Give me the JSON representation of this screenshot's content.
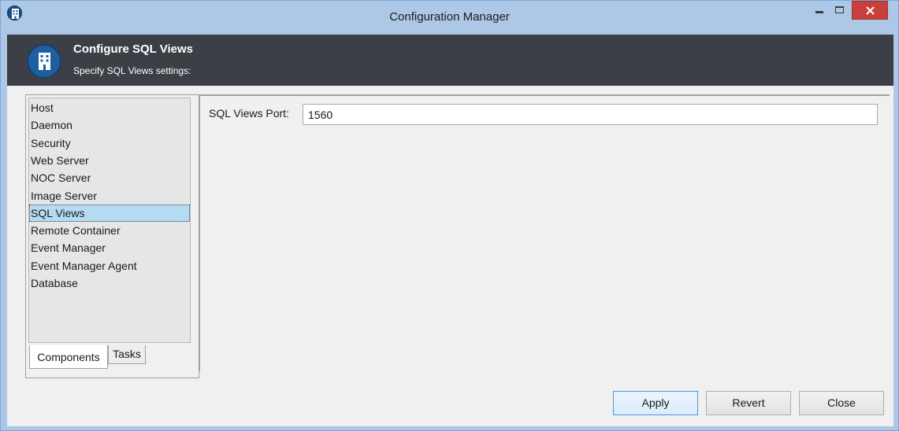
{
  "window": {
    "title": "Configuration Manager"
  },
  "banner": {
    "title": "Configure SQL Views",
    "subtitle": "Specify SQL Views settings:"
  },
  "tree": {
    "items": [
      {
        "label": "Host",
        "selected": false
      },
      {
        "label": "Daemon",
        "selected": false
      },
      {
        "label": "Security",
        "selected": false
      },
      {
        "label": "Web Server",
        "selected": false
      },
      {
        "label": "NOC Server",
        "selected": false
      },
      {
        "label": "Image Server",
        "selected": false
      },
      {
        "label": "SQL Views",
        "selected": true
      },
      {
        "label": "Remote Container",
        "selected": false
      },
      {
        "label": "Event Manager",
        "selected": false
      },
      {
        "label": "Event Manager Agent",
        "selected": false
      },
      {
        "label": "Database",
        "selected": false
      }
    ]
  },
  "tabs": {
    "components": "Components",
    "tasks": "Tasks",
    "active": "Components"
  },
  "form": {
    "port_label": "SQL Views Port:",
    "port_value": "1560"
  },
  "buttons": {
    "apply": "Apply",
    "revert": "Revert",
    "close": "Close"
  },
  "colors": {
    "accent": "#4f97d8",
    "banner_bg": "#3c3f45",
    "selection": "#b5dbf3",
    "close_button": "#c7403b"
  },
  "icons": {
    "app": "building-icon",
    "minimize": "minimize-icon",
    "maximize": "maximize-icon",
    "close": "close-icon"
  }
}
